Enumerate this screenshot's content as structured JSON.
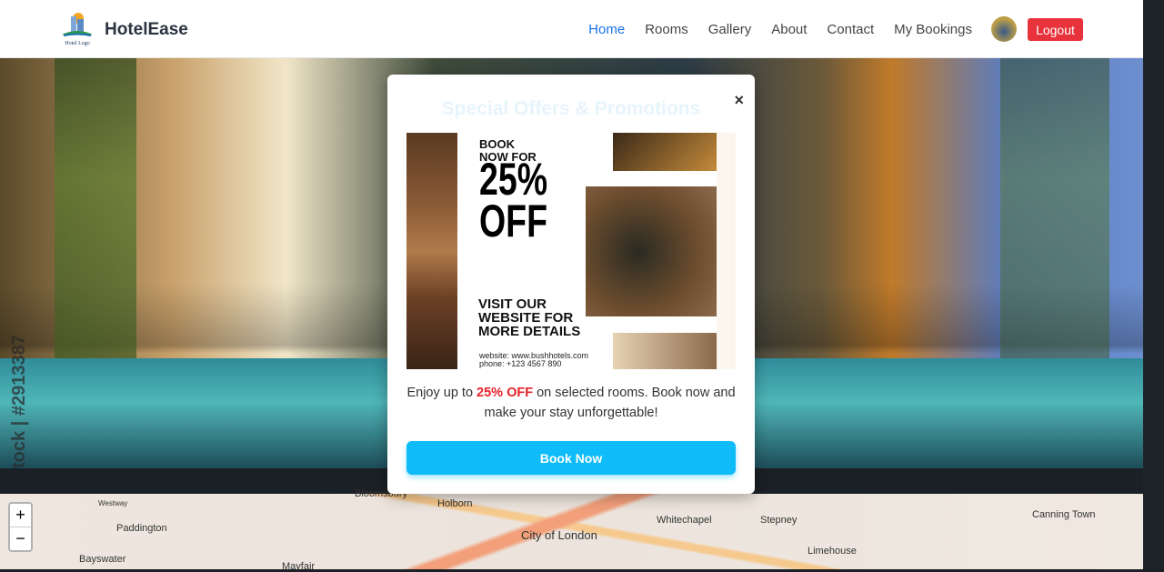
{
  "nav": {
    "brand": "HotelEase",
    "logo_text": "Hotel Logo",
    "links": [
      "Home",
      "Rooms",
      "Gallery",
      "About",
      "Contact",
      "My Bookings"
    ],
    "active": "Home",
    "logout": "Logout"
  },
  "hero": {
    "watermark": "tock | #2913387"
  },
  "modal": {
    "title": "Special Offers & Promotions",
    "close": "×",
    "promo": {
      "line1": "BOOK\nNOW FOR",
      "discount": "25%\nOFF",
      "visit": "VISIT OUR\nWEBSITE FOR\nMORE DETAILS",
      "website": "website: www.bushhotels.com",
      "phone": "phone: +123 4567 890"
    },
    "desc_pre": "Enjoy up to ",
    "desc_highlight": "25% OFF",
    "desc_post": " on selected rooms. Book now and make your stay unforgettable!",
    "book_button": "Book Now"
  },
  "map": {
    "labels": [
      "Bloomsbury",
      "Holborn",
      "Paddington",
      "Bayswater",
      "City of London",
      "Whitechapel",
      "Stepney",
      "Limehouse",
      "Canning Town",
      "Mayfair",
      "Westway"
    ],
    "zoom_in": "+",
    "zoom_out": "−"
  },
  "colors": {
    "accent": "#0fbcf9",
    "logout": "#e8333c",
    "highlight": "#e8202a",
    "active_link": "#1a73e8"
  }
}
